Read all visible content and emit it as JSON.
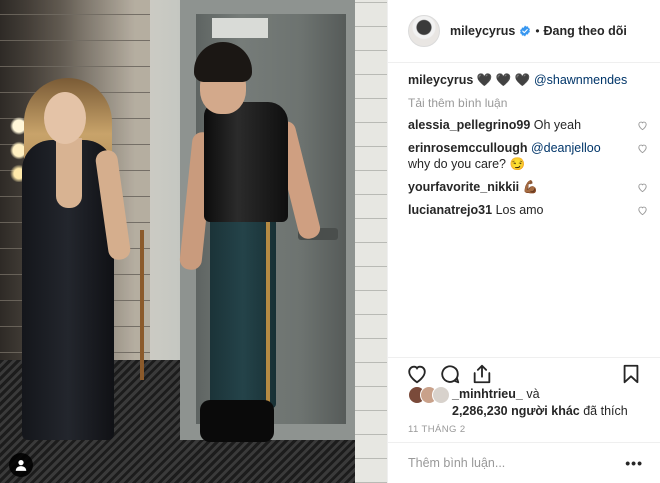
{
  "post": {
    "author": "mileycyrus",
    "separator": "•",
    "follow_status": "Đang theo dõi",
    "caption": {
      "username": "mileycyrus",
      "hearts": "🖤 🖤 🖤",
      "mention": "@shawnmendes"
    },
    "load_more": "Tải thêm bình luận",
    "comments": [
      {
        "username": "alessia_pellegrino99",
        "text": "Oh yeah",
        "mention": ""
      },
      {
        "username": "erinrosemccullough",
        "text": "why do you care? 😏",
        "mention": "@deanjelloo"
      },
      {
        "username": "yourfavorite_nikkii",
        "text": "💪🏾",
        "mention": ""
      },
      {
        "username": "lucianatrejo31",
        "text": "Los amo",
        "mention": ""
      }
    ],
    "likes": {
      "first_liker": "_minhtrieu_",
      "conj": "và",
      "count_text": "2,286,230 người khác",
      "suffix": "đã thích"
    },
    "date": "11 THÁNG 2",
    "add_comment_placeholder": "Thêm bình luận...",
    "more_label": "•••"
  },
  "colors": {
    "mention": "#003569",
    "muted": "#999999",
    "verified": "#3897f0"
  },
  "icons": [
    "user-tag-icon",
    "verified-icon",
    "heart-icon",
    "comment-icon",
    "share-icon",
    "bookmark-icon",
    "heart-small-icon",
    "more-icon"
  ]
}
